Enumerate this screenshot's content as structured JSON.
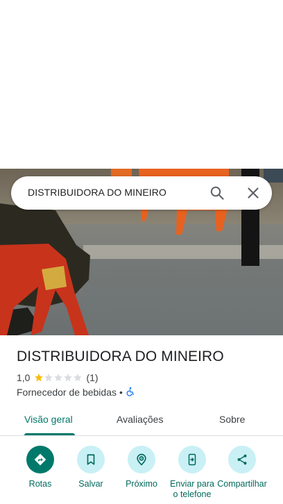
{
  "search": {
    "query": "DISTRIBUIDORA DO MINEIRO",
    "search_icon": "search-icon",
    "close_icon": "close-icon"
  },
  "place": {
    "title": "DISTRIBUIDORA DO MINEIRO",
    "rating": "1,0",
    "rating_value": 1,
    "stars_total": 5,
    "review_count": "(1)",
    "category": "Fornecedor de bebidas",
    "separator": "•",
    "accessibility_icon": "wheelchair-icon"
  },
  "tabs": [
    {
      "label": "Visão geral",
      "active": true
    },
    {
      "label": "Avaliações",
      "active": false
    },
    {
      "label": "Sobre",
      "active": false
    }
  ],
  "actions": [
    {
      "label": "Rotas",
      "icon": "directions-icon"
    },
    {
      "label": "Salvar",
      "icon": "bookmark-icon"
    },
    {
      "label": "Próximo",
      "icon": "nearby-icon"
    },
    {
      "label": "Enviar para o telefone",
      "icon": "send-to-phone-icon"
    },
    {
      "label": "Compartilhar",
      "icon": "share-icon"
    }
  ],
  "colors": {
    "accent": "#00796b",
    "action_bg": "#c9f0f5",
    "star_filled": "#fbbc04",
    "star_empty": "#dadce0",
    "accessibility": "#1a73e8"
  }
}
